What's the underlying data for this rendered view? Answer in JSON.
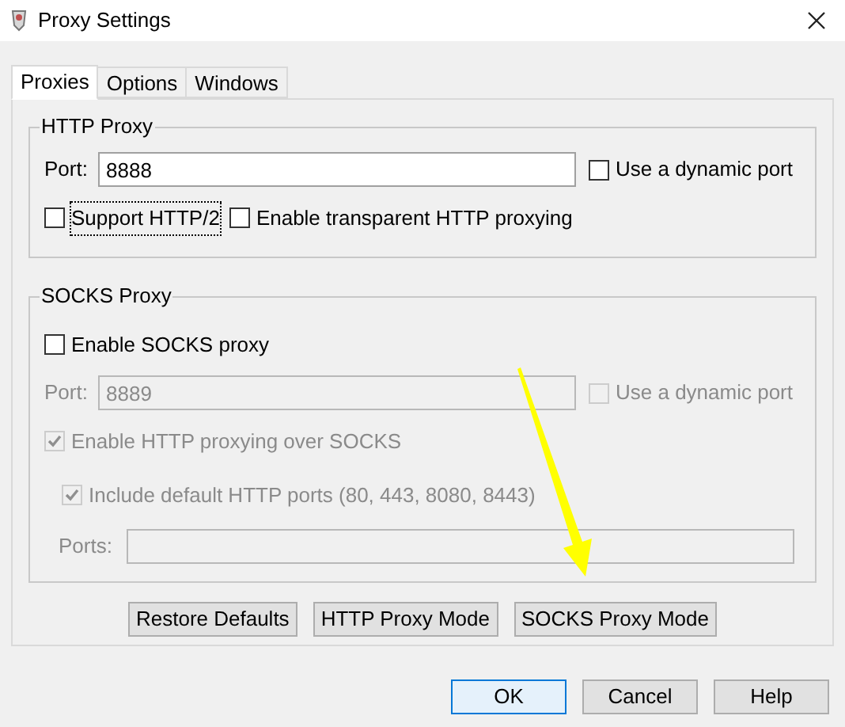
{
  "window": {
    "title": "Proxy Settings"
  },
  "tabs": [
    {
      "label": "Proxies",
      "selected": true
    },
    {
      "label": "Options",
      "selected": false
    },
    {
      "label": "Windows",
      "selected": false
    }
  ],
  "http_proxy": {
    "title": "HTTP Proxy",
    "port_label": "Port:",
    "port": "8888",
    "disabled": false,
    "dynamic_port": {
      "label": "Use a dynamic port",
      "checked": false,
      "disabled": false
    },
    "options": [
      {
        "label": "Support HTTP/2",
        "checked": false,
        "focused": true,
        "disabled": false
      },
      {
        "label": "Enable transparent HTTP proxying",
        "checked": false,
        "focused": false,
        "disabled": false
      }
    ]
  },
  "socks_proxy": {
    "title": "SOCKS Proxy",
    "enable": {
      "label": "Enable SOCKS proxy",
      "checked": false,
      "disabled": false
    },
    "port_label": "Port:",
    "port": "8889",
    "disabled": true,
    "dynamic_port": {
      "label": "Use a dynamic port",
      "checked": false,
      "disabled": true
    },
    "http_over_socks": {
      "label": "Enable HTTP proxying over SOCKS",
      "checked": true,
      "disabled": true
    },
    "include_default_ports": {
      "label": "Include default HTTP ports (80, 443, 8080, 8443)",
      "checked": true,
      "disabled": true
    },
    "ports_label": "Ports:"
  },
  "mode_buttons": [
    "Restore Defaults",
    "HTTP Proxy Mode",
    "SOCKS Proxy Mode"
  ],
  "dialog_buttons": [
    {
      "label": "OK",
      "default": true
    },
    {
      "label": "Cancel",
      "default": false
    },
    {
      "label": "Help",
      "default": false
    }
  ]
}
